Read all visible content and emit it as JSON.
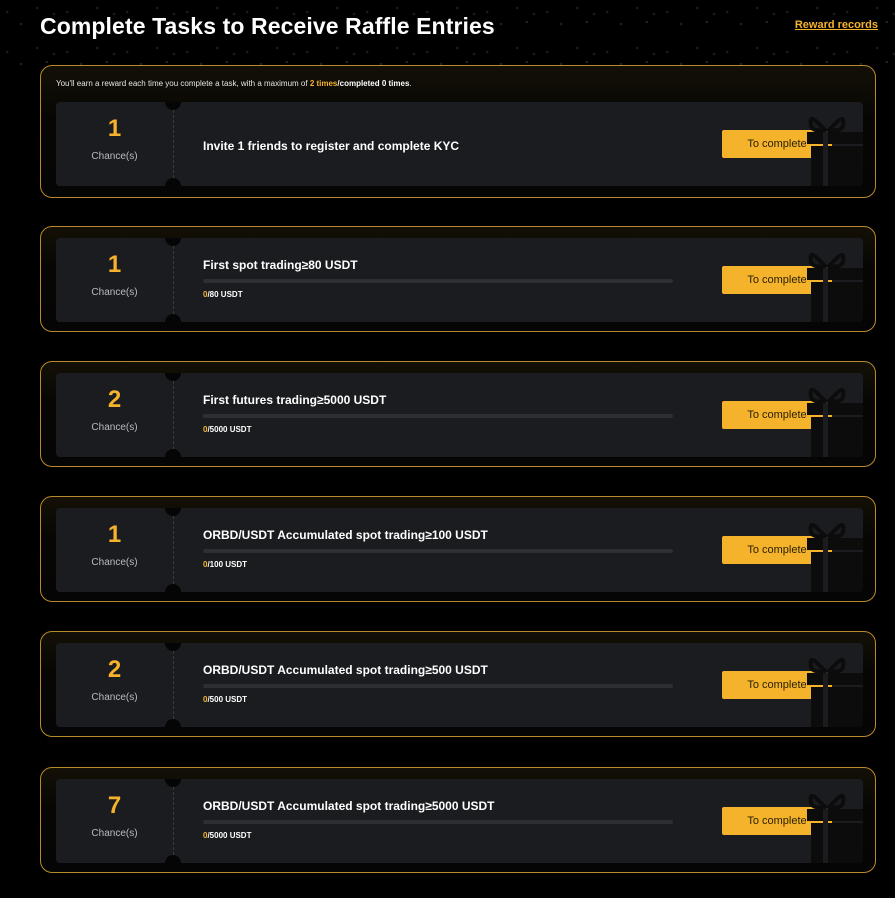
{
  "header": {
    "title": "Complete Tasks to Receive Raffle Entries",
    "reward_records_label": "Reward records"
  },
  "info": {
    "prefix": "You'll earn a reward each time you complete a task, with a maximum of",
    "max_times": "2 times",
    "completed": "/completed 0 times",
    "suffix": "."
  },
  "chance_label": "Chance(s)",
  "button_label": "To complete",
  "tasks": [
    {
      "chances": "1",
      "title": "Invite 1 friends to register and complete KYC",
      "has_progress": false
    },
    {
      "chances": "1",
      "title": "First spot trading≥80 USDT",
      "has_progress": true,
      "current": "0",
      "target": "/80 USDT",
      "progress": 0
    },
    {
      "chances": "2",
      "title": "First futures trading≥5000 USDT",
      "has_progress": true,
      "current": "0",
      "target": "/5000 USDT",
      "progress": 0
    },
    {
      "chances": "1",
      "title": "ORBD/USDT Accumulated spot trading≥100 USDT",
      "has_progress": true,
      "current": "0",
      "target": "/100 USDT",
      "progress": 0
    },
    {
      "chances": "2",
      "title": "ORBD/USDT Accumulated spot trading≥500 USDT",
      "has_progress": true,
      "current": "0",
      "target": "/500 USDT",
      "progress": 0
    },
    {
      "chances": "7",
      "title": "ORBD/USDT Accumulated spot trading≥5000 USDT",
      "has_progress": true,
      "current": "0",
      "target": "/5000 USDT",
      "progress": 0
    }
  ],
  "colors": {
    "accent": "#f5b32c",
    "card_border": "#b88a2c",
    "ticket_bg": "#1b1c1f"
  },
  "icons": {
    "gift": "gift-icon"
  }
}
